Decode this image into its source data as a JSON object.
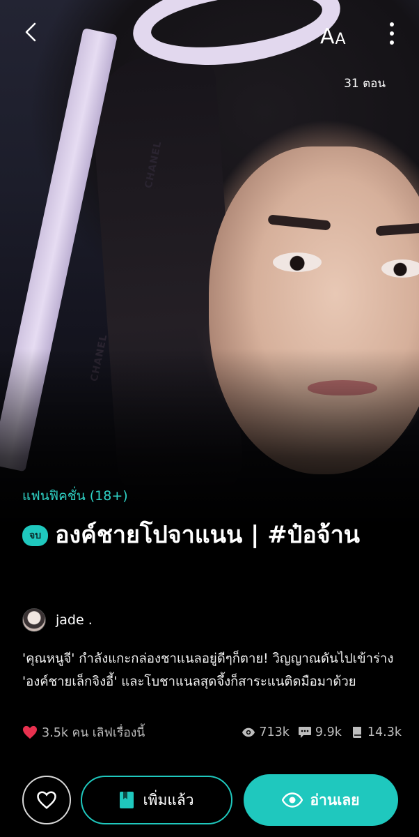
{
  "topbar": {
    "back_icon": "chevron-left-icon",
    "font_size_big": "A",
    "font_size_small": "A",
    "more_icon": "more-vertical-icon",
    "episodes": "31 ตอน"
  },
  "cover": {
    "ribbon_text_1": "CHANEL",
    "ribbon_text_2": "CHANEL"
  },
  "story": {
    "genre": "แฟนฟิคชั่น (18+)",
    "status_badge": "จบ",
    "title": "องค์ชายโปจาแนน | #ป๋อจ้าน",
    "author": "jade .",
    "synopsis": "'คุณหนูจี' กำลังแกะกล่องชาแนลอยู่ดีๆก็ตาย! วิญญาณดันไปเข้าร่าง 'องค์ชายเล็กจิงอี้' และโบชาแนลสุดจึ้งก็สาระแนติดมือมาด้วย"
  },
  "stats": {
    "loves": "3.5k คน เลิฟเรื่องนี้",
    "views": "713k",
    "comments": "9.9k",
    "library": "14.3k"
  },
  "actions": {
    "add_label": "เพิ่มแล้ว",
    "read_label": "อ่านเลย"
  },
  "colors": {
    "accent": "#1fc8be",
    "heart": "#e8314f",
    "background": "#000000"
  }
}
